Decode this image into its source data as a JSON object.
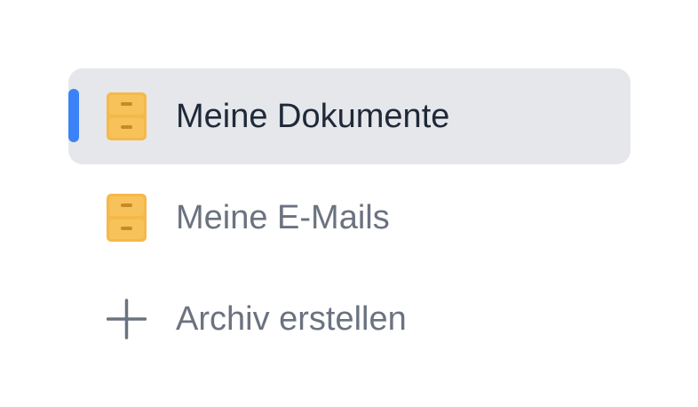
{
  "colors": {
    "active_indicator": "#3b82f6",
    "active_background": "#e5e7eb",
    "active_text": "#1f2937",
    "muted_text": "#6b7280",
    "folder_icon": "#f5b84a"
  },
  "sidebar": {
    "items": [
      {
        "label": "Meine Dokumente",
        "icon": "archive-drawer-icon",
        "active": true
      },
      {
        "label": "Meine E-Mails",
        "icon": "archive-drawer-icon",
        "active": false
      },
      {
        "label": "Archiv erstellen",
        "icon": "plus-icon",
        "active": false
      }
    ]
  }
}
